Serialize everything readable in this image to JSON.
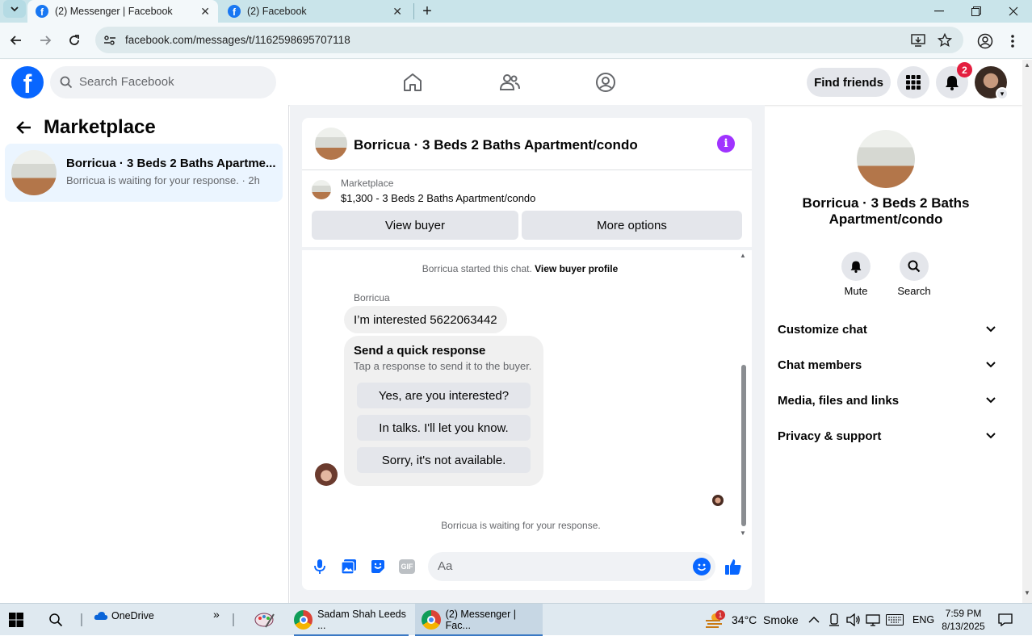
{
  "browser": {
    "tabs": [
      {
        "title": "(2) Messenger | Facebook",
        "active": true
      },
      {
        "title": "(2) Facebook",
        "active": false
      }
    ],
    "new_tab_label": "+",
    "url": "facebook.com/messages/t/1162598695707118"
  },
  "fb_header": {
    "logo_letter": "f",
    "search_placeholder": "Search Facebook",
    "find_friends": "Find friends",
    "notif_count": "2",
    "brand_color": "#0866ff"
  },
  "left_panel": {
    "title": "Marketplace",
    "conversation": {
      "name": "Borricua · 3 Beds 2 Baths Apartme...",
      "preview": "Borricua is waiting for your response. · 2h"
    }
  },
  "chat": {
    "title": "Borricua · 3 Beds 2 Baths Apartment/condo",
    "marketplace_label": "Marketplace",
    "listing": "$1,300 - 3 Beds 2 Baths Apartment/condo",
    "view_buyer": "View buyer",
    "more_options": "More options",
    "system_started": "Borricua started this chat.",
    "view_buyer_profile": "View buyer profile",
    "sender_name": "Borricua",
    "message": "I’m interested 5622063442",
    "quick_title": "Send a quick response",
    "quick_subtitle": "Tap a response to send it to the buyer.",
    "quick_replies": [
      "Yes, are you interested?",
      "In talks. I'll let you know.",
      "Sorry, it's not available."
    ],
    "waiting": "Borricua is waiting for your response.",
    "composer_placeholder": "Aa",
    "gif_label": "GIF"
  },
  "right_panel": {
    "name": "Borricua · 3 Beds 2 Baths Apartment/condo",
    "actions": [
      "Mute",
      "Search"
    ],
    "sections": [
      "Customize chat",
      "Chat members",
      "Media, files and links",
      "Privacy & support"
    ]
  },
  "taskbar": {
    "onedrive": "OneDrive",
    "chevrons": "»",
    "apps": [
      "Sadam Shah Leeds ...",
      "(2) Messenger | Fac..."
    ],
    "weather": "34°C  Smoke",
    "weather_badge": "1",
    "lang": "ENG",
    "time": "7:59 PM",
    "date": "8/13/2025"
  }
}
